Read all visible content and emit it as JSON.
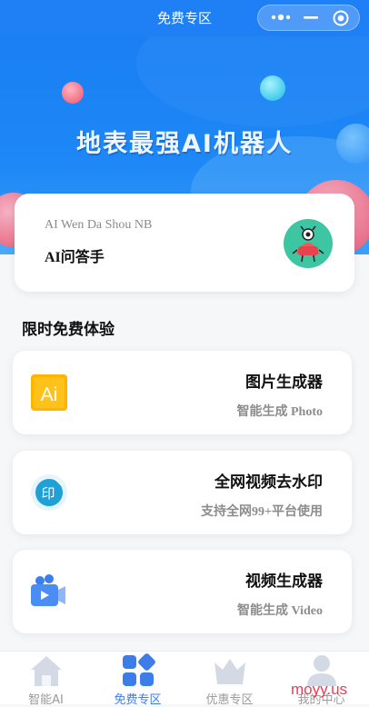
{
  "nav": {
    "title": "免费专区"
  },
  "banner": {
    "title": "地表最强AI机器人"
  },
  "hero": {
    "subtitle": "AI Wen Da Shou NB",
    "title": "AI问答手"
  },
  "section": {
    "title": "限时免费体验"
  },
  "tools": [
    {
      "name": "图片生成器",
      "desc": "智能生成 Photo",
      "icon": "ai-logo-icon"
    },
    {
      "name": "全网视频去水印",
      "desc": "支持全网99+平台使用",
      "icon": "stamp-icon"
    },
    {
      "name": "视频生成器",
      "desc": "智能生成 Video",
      "icon": "video-camera-icon"
    }
  ],
  "tabbar": {
    "items": [
      {
        "label": "智能AI",
        "icon": "house-icon",
        "active": false
      },
      {
        "label": "免费专区",
        "icon": "grid-icon",
        "active": true
      },
      {
        "label": "优惠专区",
        "icon": "crown-icon",
        "active": false
      },
      {
        "label": "我的中心",
        "icon": "user-icon",
        "active": false
      }
    ]
  },
  "watermark": "moyy.us",
  "colors": {
    "primary": "#1f7ff5",
    "tab_active": "#3d7de9",
    "tab_inactive": "#d6dbe8"
  }
}
